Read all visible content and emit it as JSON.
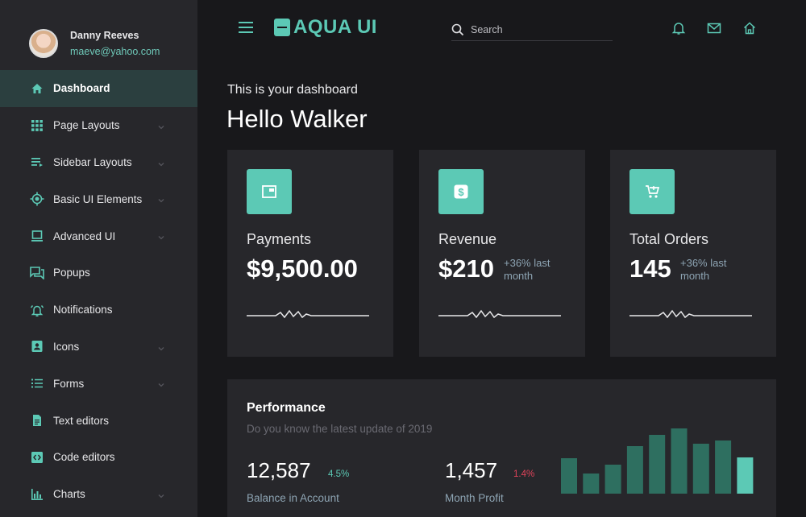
{
  "profile": {
    "name": "Danny Reeves",
    "email": "maeve@yahoo.com"
  },
  "sidebar": {
    "items": [
      {
        "label": "Dashboard",
        "icon": "home-icon",
        "active": true,
        "chevron": false
      },
      {
        "label": "Page Layouts",
        "icon": "grid-icon",
        "active": false,
        "chevron": true
      },
      {
        "label": "Sidebar Layouts",
        "icon": "list-icon",
        "active": false,
        "chevron": true
      },
      {
        "label": "Basic UI Elements",
        "icon": "target-icon",
        "active": false,
        "chevron": true
      },
      {
        "label": "Advanced UI",
        "icon": "laptop-icon",
        "active": false,
        "chevron": true
      },
      {
        "label": "Popups",
        "icon": "chat-icon",
        "active": false,
        "chevron": false
      },
      {
        "label": "Notifications",
        "icon": "bell-ring-icon",
        "active": false,
        "chevron": false
      },
      {
        "label": "Icons",
        "icon": "contact-icon",
        "active": false,
        "chevron": true
      },
      {
        "label": "Forms",
        "icon": "bullet-list-icon",
        "active": false,
        "chevron": true
      },
      {
        "label": "Text editors",
        "icon": "document-icon",
        "active": false,
        "chevron": false
      },
      {
        "label": "Code editors",
        "icon": "code-icon",
        "active": false,
        "chevron": false
      },
      {
        "label": "Charts",
        "icon": "bar-chart-icon",
        "active": false,
        "chevron": true
      }
    ]
  },
  "header": {
    "logo": "AQUA UI",
    "search_placeholder": "Search"
  },
  "page": {
    "subtitle": "This is your dashboard",
    "greeting": "Hello Walker"
  },
  "cards": [
    {
      "label": "Payments",
      "value": "$9,500.00",
      "change": "",
      "icon": "wallet-icon"
    },
    {
      "label": "Revenue",
      "value": "$210",
      "change": "+36% last month",
      "icon": "dollar-icon"
    },
    {
      "label": "Total Orders",
      "value": "145",
      "change": "+36% last month",
      "icon": "cart-icon"
    }
  ],
  "performance": {
    "title": "Performance",
    "subtitle": "Do you know the latest update of 2019",
    "balance": {
      "value": "12,587",
      "pct": "4.5%",
      "label": "Balance in Account"
    },
    "profit": {
      "value": "1,457",
      "pct": "1.4%",
      "label": "Month Profit"
    }
  },
  "chart_data": {
    "type": "bar",
    "values": [
      44,
      25,
      36,
      59,
      73,
      81,
      62,
      66,
      45
    ],
    "highlight_index": 8
  },
  "colors": {
    "accent": "#5cc9b5",
    "positive": "#5cc9b5",
    "negative": "#e0435a",
    "bar": "#2e6f60"
  }
}
